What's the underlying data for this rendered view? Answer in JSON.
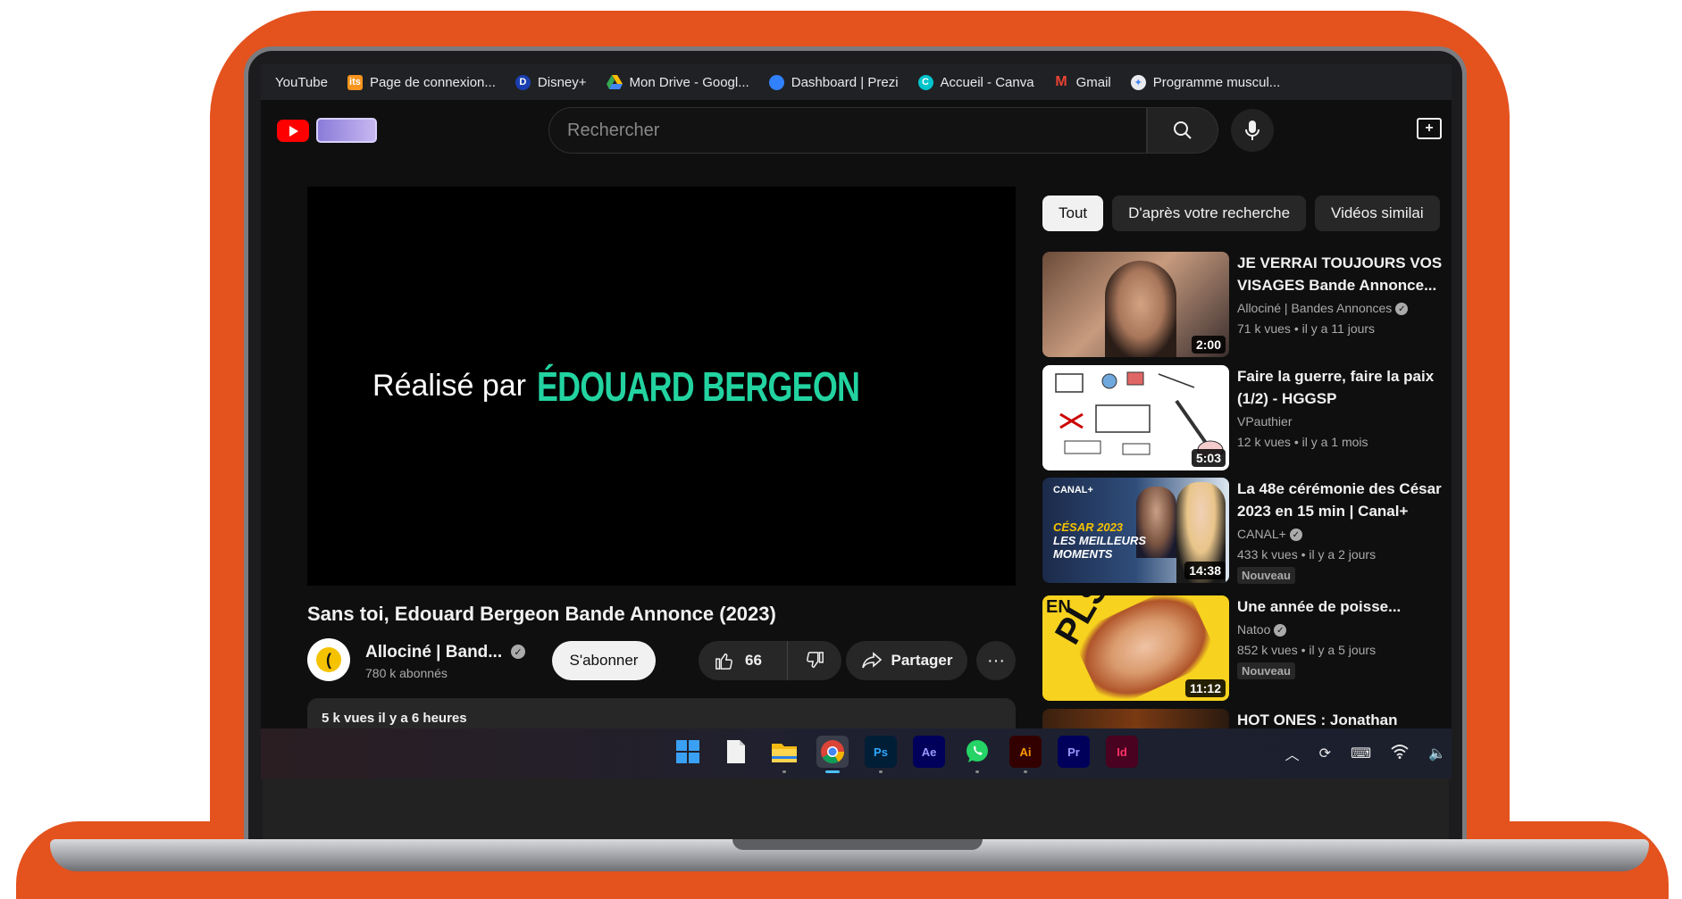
{
  "bookmarks": [
    {
      "label": "YouTube",
      "icon": "youtube-icon",
      "color": "#ff0000"
    },
    {
      "label": "Page de connexion...",
      "icon": "its-icon",
      "color": "#f7941d"
    },
    {
      "label": "Disney+",
      "icon": "disney-icon",
      "color": "#1a3fb0"
    },
    {
      "label": "Mon Drive - Googl...",
      "icon": "google-drive-icon",
      "color": "#34a853"
    },
    {
      "label": "Dashboard | Prezi",
      "icon": "prezi-icon",
      "color": "#3181ff"
    },
    {
      "label": "Accueil - Canva",
      "icon": "canva-icon",
      "color": "#00c4cc"
    },
    {
      "label": "Gmail",
      "icon": "gmail-icon",
      "color": "#ea4335"
    },
    {
      "label": "Programme muscul...",
      "icon": "chrome-site-icon",
      "color": "#4285f4"
    }
  ],
  "header": {
    "search_placeholder": "Rechercher"
  },
  "player": {
    "credit_prefix": "Réalisé par",
    "credit_name": "ÉDOUARD BERGEON"
  },
  "video": {
    "title": "Sans toi, Edouard Bergeon Bande Annonce (2023)",
    "channel": "Allociné | Band...",
    "subscribers": "780 k abonnés",
    "subscribe_label": "S'abonner",
    "likes": "66",
    "share_label": "Partager",
    "description": "5 k vues  il y a 6 heures"
  },
  "chips": [
    "Tout",
    "D'après votre recherche",
    "Vidéos similai"
  ],
  "recommendations": [
    {
      "title": "JE VERRAI TOUJOURS VOS VISAGES Bande Annonce...",
      "channel": "Allociné | Bandes Annonces",
      "meta": "71 k vues  • il y a 11 jours",
      "duration": "2:00",
      "badge": ""
    },
    {
      "title": "Faire la guerre, faire la paix (1/2) - HGGSP",
      "channel": "VPauthier",
      "meta": "12 k vues  • il y a 1 mois",
      "duration": "5:03",
      "badge": ""
    },
    {
      "title": "La 48e cérémonie des César 2023 en 15 min | Canal+",
      "channel": "CANAL+",
      "meta": "433 k vues  • il y a 2 jours",
      "duration": "14:38",
      "badge": "Nouveau",
      "thumb_tag": "CANAL+",
      "thumb_text_1": "CÉSAR 2023",
      "thumb_text_2": "LES MEILLEURS",
      "thumb_text_3": "MOMENTS"
    },
    {
      "title": "Une année de poisse...",
      "channel": "Natoo",
      "meta": "852 k vues  • il y a 5 jours",
      "duration": "11:12",
      "badge": "Nouveau",
      "thumb_text_1": "EN",
      "thumb_text_2": "PLS"
    },
    {
      "title": "HOT ONES : Jonathan Cohen",
      "channel": "",
      "meta": "",
      "duration": "",
      "badge": ""
    }
  ],
  "taskbar": {
    "apps": [
      {
        "name": "windows-start",
        "label": ""
      },
      {
        "name": "notepad",
        "label": ""
      },
      {
        "name": "file-explorer",
        "label": ""
      },
      {
        "name": "chrome",
        "label": ""
      },
      {
        "name": "photoshop",
        "label": "Ps"
      },
      {
        "name": "after-effects",
        "label": "Ae"
      },
      {
        "name": "whatsapp",
        "label": ""
      },
      {
        "name": "illustrator",
        "label": "Ai"
      },
      {
        "name": "premiere-pro",
        "label": "Pr"
      },
      {
        "name": "indesign",
        "label": "Id"
      }
    ]
  },
  "colors": {
    "frame_orange": "#e4521e",
    "yt_background": "#0f0f0f",
    "credit_green": "#22d3a0",
    "yt_red": "#ff0000"
  }
}
